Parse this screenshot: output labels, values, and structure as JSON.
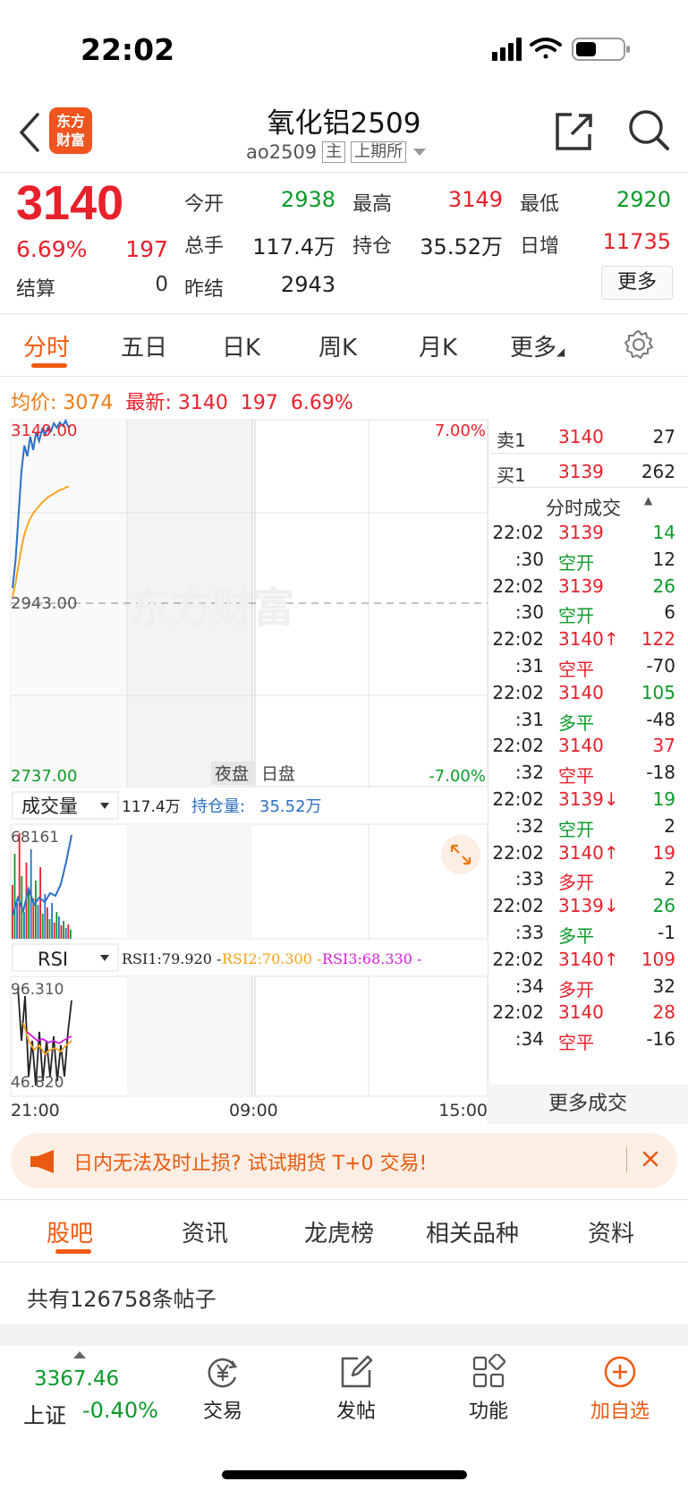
{
  "status_bar": {
    "time": "22:02"
  },
  "header": {
    "logo_line1": "东方",
    "logo_line2": "财富",
    "title": "氧化铝2509",
    "code": "ao2509",
    "tag_main": "主",
    "tag_exchange": "上期所"
  },
  "quote": {
    "price": "3140",
    "change_pct": "6.69%",
    "change": "197",
    "settle_label": "结算",
    "settle_value": "0",
    "fields": [
      {
        "label": "今开",
        "value": "2938",
        "color": "#0c9a2a"
      },
      {
        "label": "最高",
        "value": "3149",
        "color": "#e8202b"
      },
      {
        "label": "最低",
        "value": "2920",
        "color": "#0c9a2a"
      },
      {
        "label": "总手",
        "value": "117.4万",
        "color": "#222222"
      },
      {
        "label": "持仓",
        "value": "35.52万",
        "color": "#222222"
      },
      {
        "label": "日增",
        "value": "11735",
        "color": "#e8202b"
      },
      {
        "label": "昨结",
        "value": "2943",
        "color": "#222222"
      }
    ],
    "more_label": "更多"
  },
  "tabs": [
    "分时",
    "五日",
    "日K",
    "周K",
    "月K",
    "更多"
  ],
  "info_line": {
    "avg_label": "均价:",
    "avg_value": "3074",
    "latest_label": "最新:",
    "latest_value": "3140",
    "latest_change": "197",
    "latest_pct": "6.69%"
  },
  "chart_data": {
    "type": "line",
    "price_axis": {
      "top": "3149.00",
      "mid": "2943.00",
      "bottom": "2737.00"
    },
    "pct_axis": {
      "top": "7.00%",
      "bottom": "-7.00%"
    },
    "watermark": "东方财富",
    "session_labels": [
      "夜盘",
      "日盘"
    ],
    "time_ticks": [
      "21:00",
      "09:00",
      "15:00"
    ],
    "ylim": [
      2737,
      3149
    ],
    "series": [
      {
        "values": [
          2960,
          2990,
          3040,
          3090,
          3120,
          3108,
          3130,
          3115,
          3135,
          3125,
          3138,
          3132,
          3140,
          3136,
          3145,
          3140,
          3146,
          3142,
          3148,
          3140
        ]
      },
      {
        "values": [
          2950,
          2965,
          2985,
          3005,
          3020,
          3030,
          3038,
          3044,
          3048,
          3052,
          3056,
          3059,
          3062,
          3064,
          3066,
          3068,
          3070,
          3071,
          3073,
          3074
        ]
      }
    ],
    "volume_panel": {
      "selector": "成交量",
      "volume": "117.4万",
      "oi_label": "持仓量:",
      "oi_value": "35.52万",
      "max_label": "68161"
    },
    "rsi_panel": {
      "selector": "RSI",
      "rsi1": "RSI1:79.920 -",
      "rsi2": "RSI2:70.300 -",
      "rsi3": "RSI3:68.330 -",
      "top_label": "96.310",
      "bottom_label": "46.820"
    }
  },
  "order_book": [
    {
      "label": "卖1",
      "price": "3140",
      "volume": "27"
    },
    {
      "label": "买1",
      "price": "3139",
      "volume": "262"
    }
  ],
  "trades_header": "分时成交",
  "trades": [
    {
      "time": "22:02",
      "price": "3139",
      "price_color": "#e8202b",
      "vol": "14",
      "vol_color": "#0c9a2a"
    },
    {
      "time": ":30",
      "price": "空开",
      "price_color": "#0c9a2a",
      "vol": "12",
      "vol_color": "#222222"
    },
    {
      "time": "22:02",
      "price": "3139",
      "price_color": "#e8202b",
      "vol": "26",
      "vol_color": "#0c9a2a"
    },
    {
      "time": ":30",
      "price": "空开",
      "price_color": "#0c9a2a",
      "vol": "6",
      "vol_color": "#222222"
    },
    {
      "time": "22:02",
      "price": "3140↑",
      "price_color": "#e8202b",
      "vol": "122",
      "vol_color": "#e8202b"
    },
    {
      "time": ":31",
      "price": "空平",
      "price_color": "#e8202b",
      "vol": "-70",
      "vol_color": "#222222"
    },
    {
      "time": "22:02",
      "price": "3140",
      "price_color": "#e8202b",
      "vol": "105",
      "vol_color": "#0c9a2a"
    },
    {
      "time": ":31",
      "price": "多平",
      "price_color": "#0c9a2a",
      "vol": "-48",
      "vol_color": "#222222"
    },
    {
      "time": "22:02",
      "price": "3140",
      "price_color": "#e8202b",
      "vol": "37",
      "vol_color": "#e8202b"
    },
    {
      "time": ":32",
      "price": "空平",
      "price_color": "#e8202b",
      "vol": "-18",
      "vol_color": "#222222"
    },
    {
      "time": "22:02",
      "price": "3139↓",
      "price_color": "#e8202b",
      "vol": "19",
      "vol_color": "#0c9a2a"
    },
    {
      "time": ":32",
      "price": "空开",
      "price_color": "#0c9a2a",
      "vol": "2",
      "vol_color": "#222222"
    },
    {
      "time": "22:02",
      "price": "3140↑",
      "price_color": "#e8202b",
      "vol": "19",
      "vol_color": "#e8202b"
    },
    {
      "time": ":33",
      "price": "多开",
      "price_color": "#e8202b",
      "vol": "2",
      "vol_color": "#222222"
    },
    {
      "time": "22:02",
      "price": "3139↓",
      "price_color": "#e8202b",
      "vol": "26",
      "vol_color": "#0c9a2a"
    },
    {
      "time": ":33",
      "price": "多平",
      "price_color": "#0c9a2a",
      "vol": "-1",
      "vol_color": "#222222"
    },
    {
      "time": "22:02",
      "price": "3140↑",
      "price_color": "#e8202b",
      "vol": "109",
      "vol_color": "#e8202b"
    },
    {
      "time": ":34",
      "price": "多开",
      "price_color": "#e8202b",
      "vol": "32",
      "vol_color": "#222222"
    },
    {
      "time": "22:02",
      "price": "3140",
      "price_color": "#e8202b",
      "vol": "28",
      "vol_color": "#e8202b"
    },
    {
      "time": ":34",
      "price": "空平",
      "price_color": "#e8202b",
      "vol": "-16",
      "vol_color": "#222222"
    }
  ],
  "more_trades": "更多成交",
  "promo": {
    "text": "日内无法及时止损? 试试期货 T+0 交易!"
  },
  "bottom_tabs": [
    "股吧",
    "资讯",
    "龙虎榜",
    "相关品种",
    "资料"
  ],
  "post_count_text": "共有126758条帖子",
  "bottom_bar": {
    "index_value": "3367.46",
    "index_name": "上证",
    "index_change": "-0.40%",
    "buttons": [
      {
        "label": "交易",
        "icon": "yen-exchange-icon"
      },
      {
        "label": "发帖",
        "icon": "edit-post-icon"
      },
      {
        "label": "功能",
        "icon": "grid-apps-icon"
      },
      {
        "label": "加自选",
        "icon": "plus-circle-icon"
      }
    ]
  }
}
